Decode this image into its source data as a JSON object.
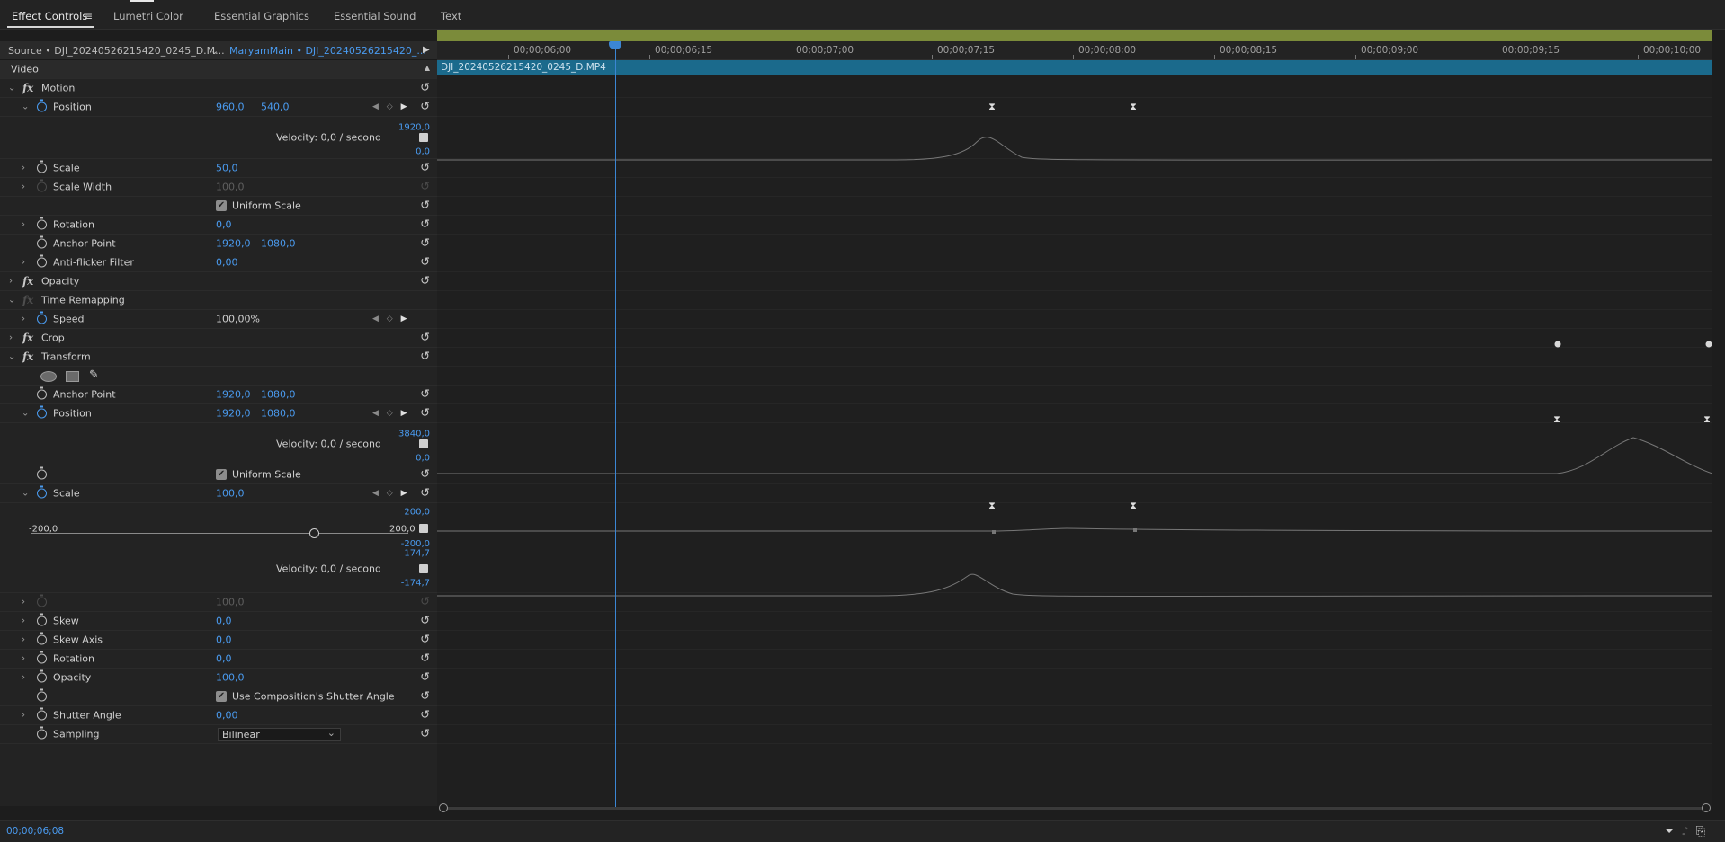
{
  "tabs": [
    {
      "label": "Effect Controls"
    },
    {
      "label": "Lumetri Color"
    },
    {
      "label": "Essential Graphics"
    },
    {
      "label": "Essential Sound"
    },
    {
      "label": "Text"
    }
  ],
  "source_header": {
    "source": "Source • DJI_20240526215420_0245_D.M...",
    "sequence": "MaryamMain • DJI_20240526215420_..."
  },
  "clip_name": "DJI_20240526215420_0245_D.MP4",
  "section": "Video",
  "ruler_timecodes": [
    "00;00;06;00",
    "00;00;06;15",
    "00;00;07;00",
    "00;00;07;15",
    "00;00;08;00",
    "00;00;08;15",
    "00;00;09;00",
    "00;00;09;15",
    "00;00;10;00"
  ],
  "motion": {
    "title": "Motion",
    "position": {
      "label": "Position",
      "x": "960,0",
      "y": "540,0"
    },
    "position_graph": {
      "max": "1920,0",
      "min": "0,0",
      "velocity": "Velocity: 0,0 / second"
    },
    "scale": {
      "label": "Scale",
      "value": "50,0"
    },
    "scale_width": {
      "label": "Scale Width",
      "value": "100,0"
    },
    "uniform_scale": "Uniform Scale",
    "rotation": {
      "label": "Rotation",
      "value": "0,0"
    },
    "anchor": {
      "label": "Anchor Point",
      "x": "1920,0",
      "y": "1080,0"
    },
    "antiflicker": {
      "label": "Anti-flicker Filter",
      "value": "0,00"
    }
  },
  "opacity": {
    "title": "Opacity"
  },
  "time_remap": {
    "title": "Time Remapping",
    "speed_label": "Speed",
    "speed_value": "100,00%"
  },
  "crop": {
    "title": "Crop"
  },
  "transform": {
    "title": "Transform",
    "anchor": {
      "label": "Anchor Point",
      "x": "1920,0",
      "y": "1080,0"
    },
    "position": {
      "label": "Position",
      "x": "1920,0",
      "y": "1080,0"
    },
    "position_graph": {
      "max": "3840,0",
      "min": "0,0",
      "velocity": "Velocity: 0,0 / second"
    },
    "uniform_scale": "Uniform Scale",
    "scale": {
      "label": "Scale",
      "value": "100,0"
    },
    "scale_slider": {
      "min": "-200,0",
      "max": "200,0",
      "level": 0.75
    },
    "scale_graph": {
      "max": "200,0",
      "min": "-200,0"
    },
    "scale_velocity": {
      "max": "174,7",
      "min": "-174,7",
      "velocity": "Velocity: 0,0 / second"
    },
    "scale_width_value": "100,0",
    "skew": {
      "label": "Skew",
      "value": "0,0"
    },
    "skew_axis": {
      "label": "Skew Axis",
      "value": "0,0"
    },
    "rotation": {
      "label": "Rotation",
      "value": "0,0"
    },
    "opacity": {
      "label": "Opacity",
      "value": "100,0"
    },
    "use_comp_shutter": "Use Composition's Shutter Angle",
    "shutter_angle": {
      "label": "Shutter Angle",
      "value": "0,00"
    },
    "sampling": {
      "label": "Sampling",
      "value": "Bilinear"
    }
  },
  "status_timecode": "00;00;06;08",
  "colors": {
    "accent": "#4a9bf0",
    "clip": "#1b6a8c",
    "work_area": "#7b8b3a"
  }
}
